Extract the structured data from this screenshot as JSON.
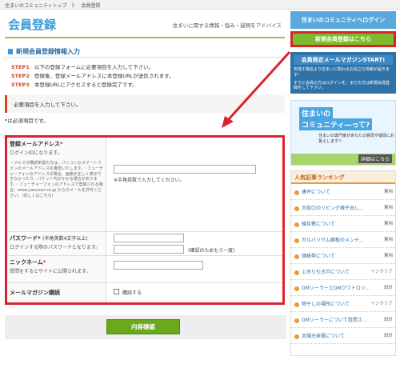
{
  "breadcrumb": [
    "住まいのコミュニティトップ",
    "》",
    "会員登録"
  ],
  "header": {
    "title": "会員登録",
    "tagline": "住まいに関する情報・悩み・疑問をアドバイス"
  },
  "section": {
    "title": "新規会員登録情報入力"
  },
  "steps": [
    {
      "label": "STEP1",
      "text": "以下の登録フォームに必要項目を入力して下さい。"
    },
    {
      "label": "STEP2",
      "text": "登録後、登録メールアドレスに本登録URLが送信されます。"
    },
    {
      "label": "STEP3",
      "text": "本登録URLにアクセスすると登録完了です。"
    }
  ],
  "notice": "必要項目を入力して下さい。",
  "required_note": "*は必須項目です。",
  "form": {
    "email": {
      "label": "登録メールアドレス",
      "req": "*",
      "sub": "ログインIDになります。",
      "notes": "・メルマガ購読希望の方は、パソコンかスマートフォンのメールアドレスを推奨いたします。・フューチャーフォンのアドレスの場合、画像が正しく表示できなかったり、パケット代がかかる場合があります。・フューチャーフォンのアドレスで登録される場合、www.yasunari.co.jp からのメールを許可ください。（詳しくはこちら）",
      "hint": "※半角英数で入力してください。"
    },
    "password": {
      "label": "パスワード*",
      "label_note": "(半角英数4文字以上)",
      "sub": "ログインする際のパスワードとなります。",
      "confirm_hint": "(確認のためもう一度)"
    },
    "nickname": {
      "label": "ニックネーム",
      "req": "*",
      "sub": "質問をするとサイトに公開されます。"
    },
    "magazine": {
      "label": "メールマガジン購読",
      "checkbox_label": "購読する"
    }
  },
  "submit_label": "内容確認",
  "sidebar": {
    "login": "住まいのコミュニティへログイン",
    "register": "新規会員登録はこちら",
    "magazine": {
      "title": "会員限定メールマガジンSTART!",
      "body1": "安成工務店より住まいに関わるお役立ち情報が届きます!",
      "body2": "すでに会員の方はログインを。まだの方は新規会員登録をして下さい。"
    },
    "banner": {
      "line1": "住まいの",
      "line2": "コミュニティ―って?",
      "line3": "住まいの専門家があなたの質問や疑問にお答えします!!",
      "detail": "詳細はこちら"
    },
    "ranking": {
      "title": "人気記事ランキング",
      "items": [
        {
          "title": "建坪について",
          "cat": "費用"
        },
        {
          "title": "大阪口のリビング様子出し...",
          "cat": "費用"
        },
        {
          "title": "維持費について",
          "cat": "費用"
        },
        {
          "title": "ガルバリウム鋼板のメンテ...",
          "cat": "費用"
        },
        {
          "title": "価格帯について",
          "cat": "費用"
        },
        {
          "title": "上吊り引き戸について",
          "cat": "インテリア"
        },
        {
          "title": "OMソーラーとOMクワトロソ...",
          "cat": "設計"
        },
        {
          "title": "物干しの場所について",
          "cat": "インテリア"
        },
        {
          "title": "OMソーラーについて質問さ...",
          "cat": "設計"
        },
        {
          "title": "太陽光発電について",
          "cat": "設計"
        }
      ]
    }
  }
}
